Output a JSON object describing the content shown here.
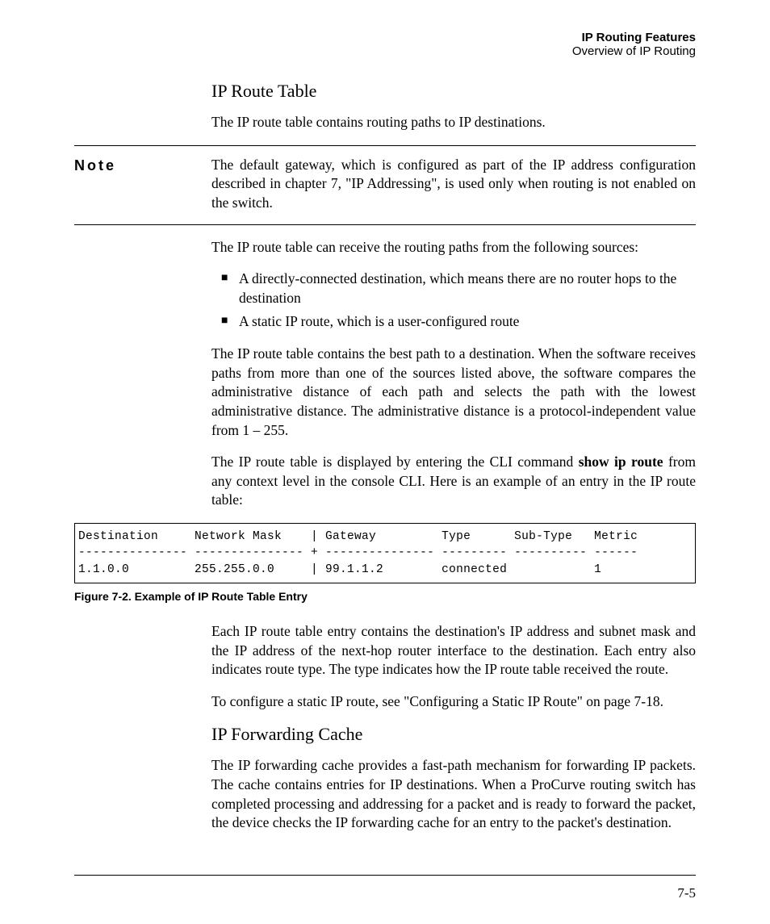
{
  "header": {
    "title": "IP Routing Features",
    "subtitle": "Overview of IP Routing"
  },
  "section1": {
    "heading": "IP Route Table",
    "intro": "The IP route table contains routing paths to IP destinations."
  },
  "note": {
    "label": "Note",
    "text": "The default gateway, which is configured as part of the IP address configuration described in chapter 7, \"IP Addressing\", is used only when routing is not enabled on the switch."
  },
  "sources": {
    "intro": "The IP route table can receive the routing paths from the following sources:",
    "items": [
      "A directly-connected destination, which means there are no router hops to the destination",
      "A static IP route, which is a user-configured route"
    ]
  },
  "bestpath": "The IP route table contains the best path to a destination. When the software receives paths from more than one of the sources listed above, the software compares the administrative distance of each path and selects the path with the lowest administrative distance. The administrative distance is a protocol-independent value from 1 – 255.",
  "cli": {
    "pre": "The IP route table is displayed by entering the CLI command ",
    "cmd": "show ip route",
    "post": " from any context level in the console CLI. Here is an example of an entry in the IP route table:"
  },
  "code": "Destination     Network Mask    | Gateway         Type      Sub-Type   Metric\n--------------- --------------- + --------------- --------- ---------- ------\n1.1.0.0         255.255.0.0     | 99.1.1.2        connected            1",
  "figure": "Figure 7-2.   Example of IP Route Table Entry",
  "entry_desc": "Each IP route table entry contains the destination's IP address and subnet mask and the IP address of the next-hop router interface to the destination. Each entry also indicates route type. The type indicates how the IP route table received the route.",
  "static_ref": "To configure a static IP route, see \"Configuring a Static IP Route\" on page 7-18.",
  "section2": {
    "heading": "IP Forwarding Cache",
    "text": "The IP forwarding cache provides a fast-path mechanism for forwarding IP packets. The cache contains entries for IP destinations. When a ProCurve routing switch has completed processing and addressing for a packet and is ready to forward the packet, the device checks the IP forwarding cache for an entry to the packet's destination."
  },
  "page_number": "7-5"
}
